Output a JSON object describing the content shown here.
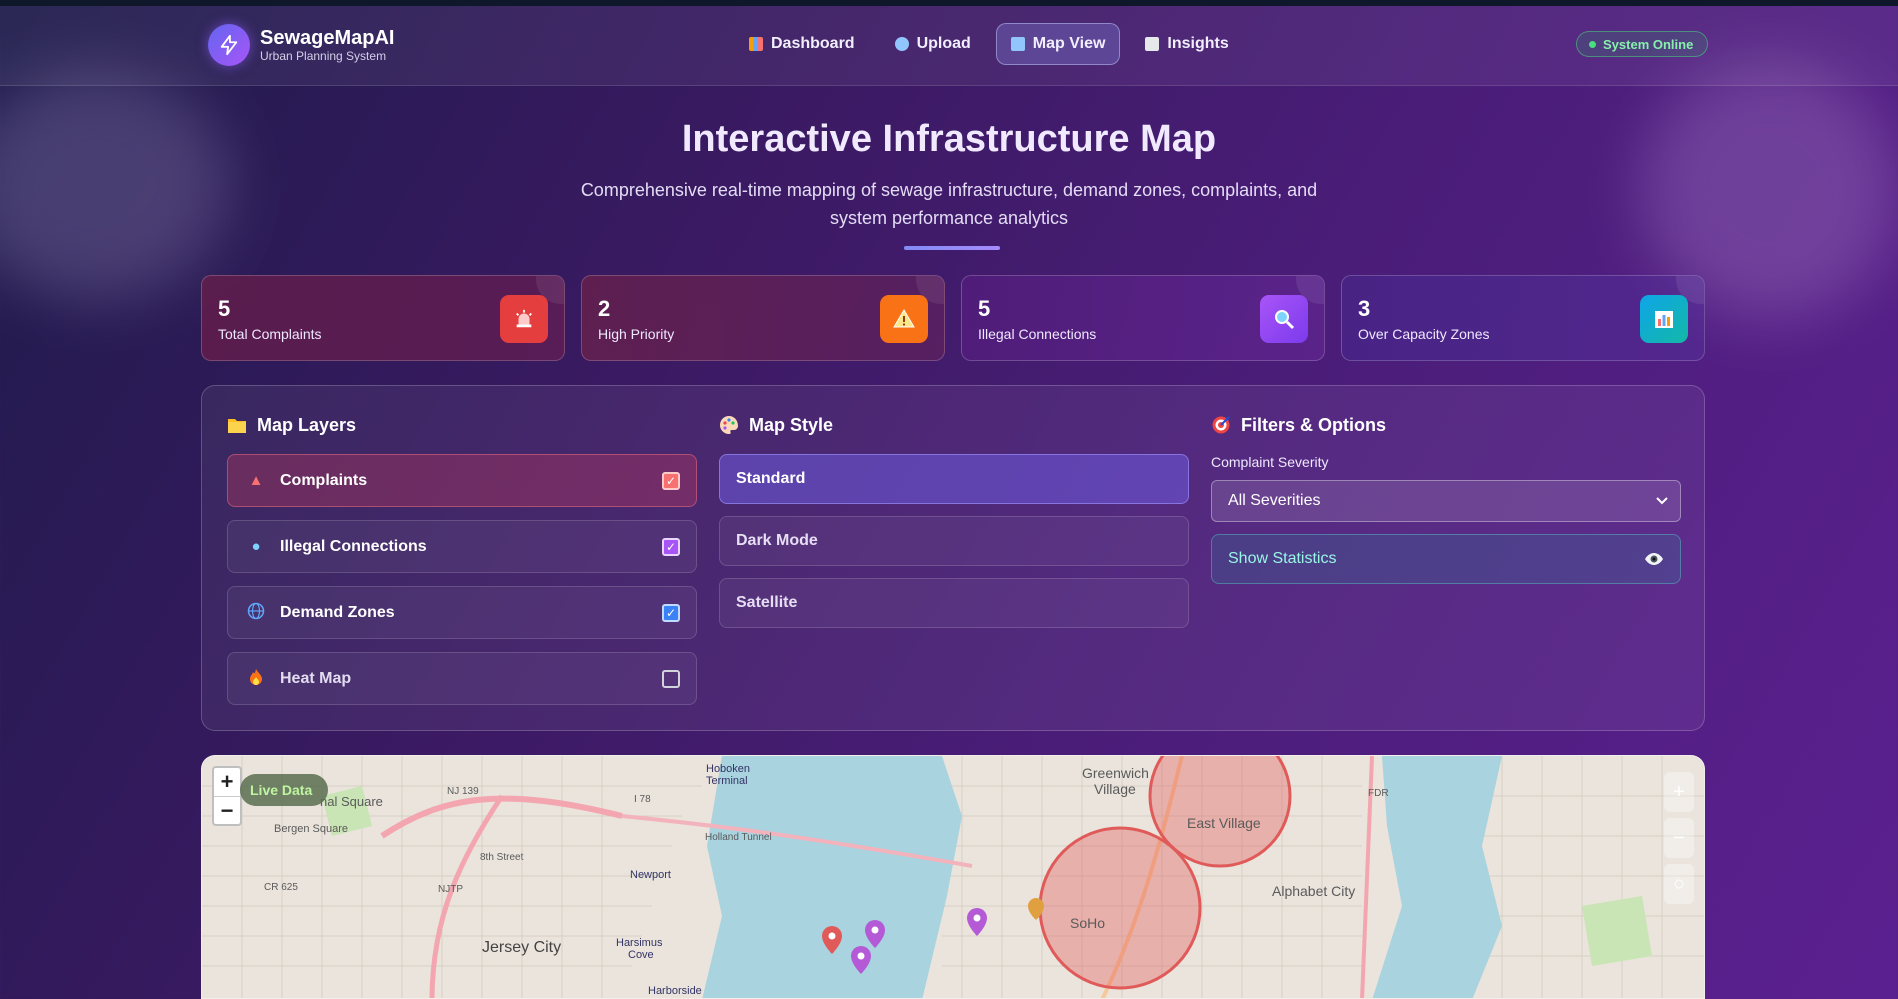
{
  "app": {
    "name": "SewageMapAI",
    "subtitle": "Urban Planning System"
  },
  "nav": {
    "items": [
      {
        "label": "Dashboard",
        "icon": "bar-chart-icon",
        "active": false
      },
      {
        "label": "Upload",
        "icon": "upload-icon",
        "active": false
      },
      {
        "label": "Map View",
        "icon": "map-icon",
        "active": true
      },
      {
        "label": "Insights",
        "icon": "trend-icon",
        "active": false
      }
    ],
    "status": "System Online"
  },
  "page": {
    "title": "Interactive Infrastructure Map",
    "subtitle": "Comprehensive real-time mapping of sewage infrastructure, demand zones, complaints, and system performance analytics"
  },
  "stats": [
    {
      "value": "5",
      "label": "Total Complaints",
      "icon": "siren-icon",
      "color": "#e53e3e"
    },
    {
      "value": "2",
      "label": "High Priority",
      "icon": "warning-icon",
      "color": "#f97316"
    },
    {
      "value": "5",
      "label": "Illegal Connections",
      "icon": "magnifier-icon",
      "color": "#a855f7"
    },
    {
      "value": "3",
      "label": "Over Capacity Zones",
      "icon": "bar-chart-icon",
      "color": "#14b8a6"
    }
  ],
  "layers": {
    "title": "Map Layers",
    "items": [
      {
        "label": "Complaints",
        "icon": "siren-icon",
        "checked": true
      },
      {
        "label": "Illegal Connections",
        "icon": "magnifier-icon",
        "checked": true
      },
      {
        "label": "Demand Zones",
        "icon": "globe-icon",
        "checked": true
      },
      {
        "label": "Heat Map",
        "icon": "fire-icon",
        "checked": false
      }
    ]
  },
  "map_style": {
    "title": "Map Style",
    "options": [
      "Standard",
      "Dark Mode",
      "Satellite"
    ],
    "selected": "Standard"
  },
  "filters": {
    "title": "Filters & Options",
    "severity_label": "Complaint Severity",
    "severity_value": "All Severities",
    "stats_toggle": "Show Statistics"
  },
  "map": {
    "live_label": "Live Data",
    "zoom_in": "+",
    "zoom_out": "−",
    "places": {
      "greenwich": "Greenwich",
      "village": "Village",
      "east_village": "East Village",
      "alphabet_city": "Alphabet City",
      "soho": "SoHo",
      "jersey_city": "Jersey City",
      "newport": "Newport",
      "harsimus": "Harsimus",
      "cove": "Cove",
      "harborside": "Harborside",
      "bergen": "Bergen Square",
      "hoboken": "Hoboken",
      "terminal": "Terminal",
      "holland": "Holland Tunnel",
      "fdr": "FDR",
      "nj139": "NJ 139",
      "i78": "I 78",
      "cr625": "CR 625",
      "street8": "8th Street",
      "njtp": "NJTP",
      "square": "nal Square"
    }
  }
}
